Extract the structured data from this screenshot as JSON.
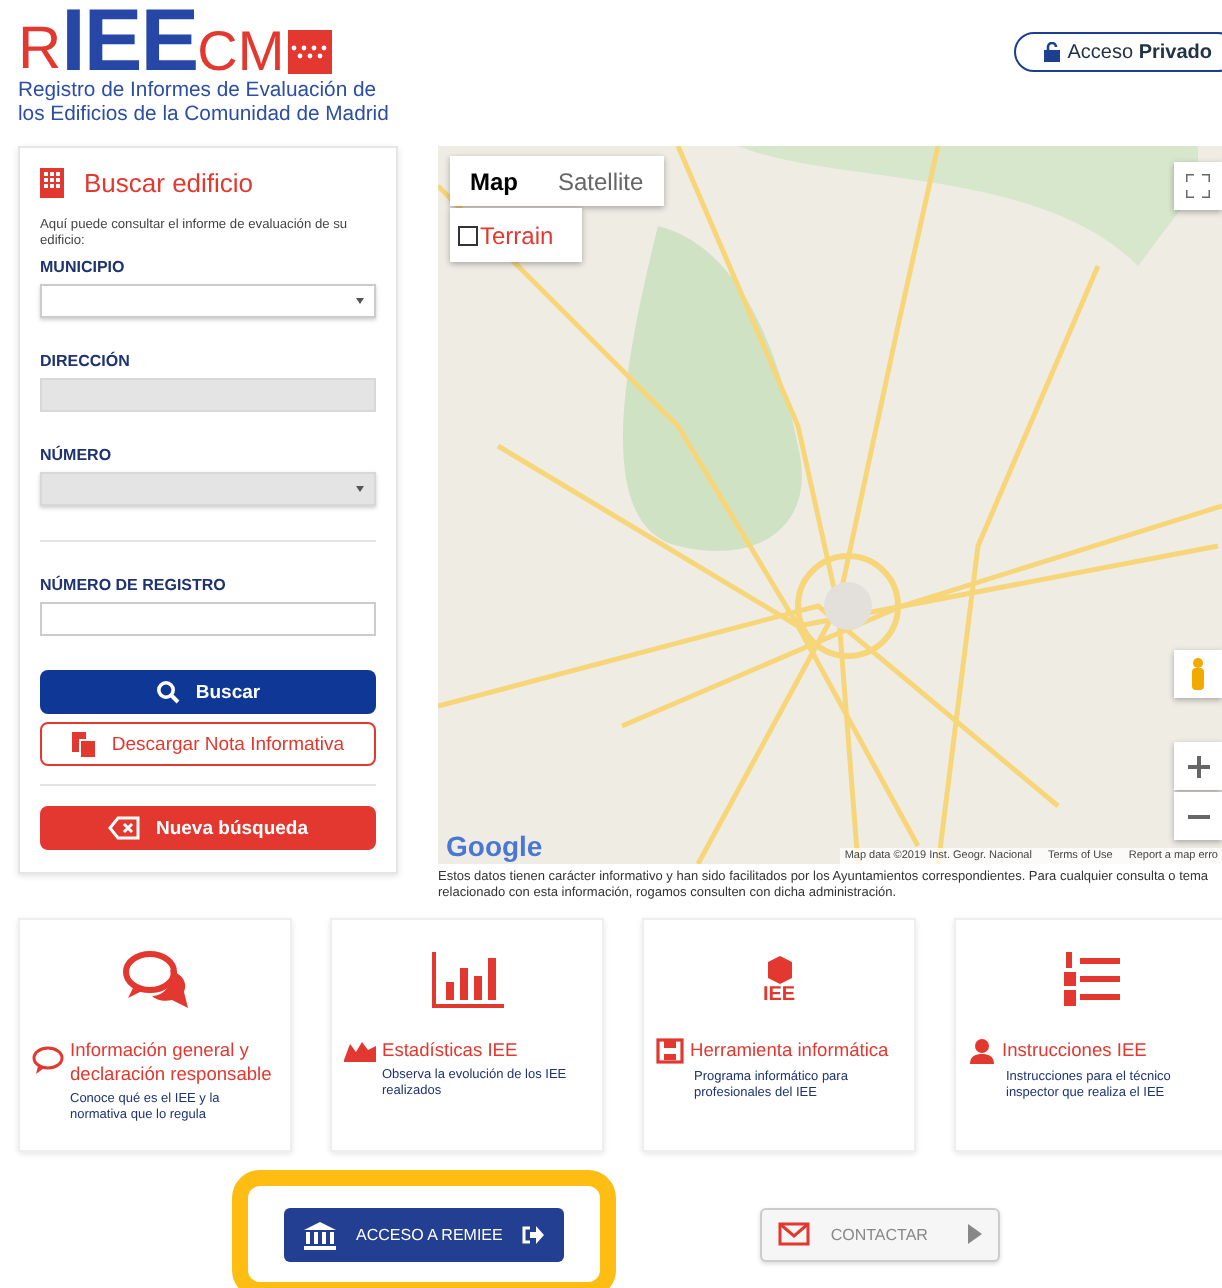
{
  "header": {
    "logo": {
      "first": "R",
      "middle": "IEE",
      "last": "CM"
    },
    "subtitle_lines": [
      "Registro  de  Informes de Evaluación de",
      "los Edificios de la Comunidad de Madrid"
    ],
    "private_access": {
      "prefix": "Acceso",
      "bold": "Privado"
    }
  },
  "search_panel": {
    "title": "Buscar edificio",
    "intro": "Aquí puede consultar el informe de evaluación de su edificio:",
    "fields": [
      {
        "kind": "select",
        "label": "MUNICIPIO",
        "disabled": false,
        "separated": false
      },
      {
        "kind": "text",
        "label": "DIRECCIÓN",
        "disabled": true,
        "separated": false
      },
      {
        "kind": "select",
        "label": "NÚMERO",
        "disabled": true,
        "separated": false
      },
      {
        "kind": "text",
        "label": "NÚMERO DE REGISTRO",
        "disabled": false,
        "separated": true
      }
    ],
    "buttons": [
      {
        "kind": "primary",
        "label": "Buscar",
        "separated": false
      },
      {
        "kind": "outline",
        "label": "Descargar Nota Informativa",
        "separated": false
      },
      {
        "kind": "danger",
        "label": "Nueva búsqueda",
        "separated": true
      }
    ]
  },
  "map": {
    "map_types": [
      {
        "label": "Map",
        "selected": true
      },
      {
        "label": "Satellite",
        "selected": false
      }
    ],
    "terrain": {
      "label": "Terrain",
      "checked": false
    },
    "attribution": {
      "logo": "Google",
      "data": "Map data ©2019 Inst. Geogr. Nacional",
      "terms": "Terms of Use",
      "report": "Report a map erro"
    }
  },
  "disclaimer": "Estos datos tienen carácter informativo y han sido facilitados por los Ayuntamientos correspondientes. Para cualquier consulta o tema relacionado con esta información, rogamos consulten con dicha administración.",
  "cards": [
    {
      "kind": "chat",
      "title": "Información general y declaración responsable",
      "description": "Conoce qué es el IEE y la normativa que lo regula"
    },
    {
      "kind": "chart",
      "title": "Estadísticas IEE",
      "description": "Observa la evolución de los IEE realizados"
    },
    {
      "kind": "software",
      "title": "Herramienta informática",
      "description": "Programa informático para profesionales del IEE",
      "badge": "IEE"
    },
    {
      "kind": "list",
      "title": "Instrucciones IEE",
      "description": "Instrucciones para el técnico inspector que realiza el IEE"
    }
  ],
  "bottom_buttons": [
    {
      "kind": "primary",
      "label": "ACCESO A REMIEE",
      "highlighted": true
    },
    {
      "kind": "secondary",
      "label": "CONTACTAR",
      "highlighted": false
    }
  ]
}
